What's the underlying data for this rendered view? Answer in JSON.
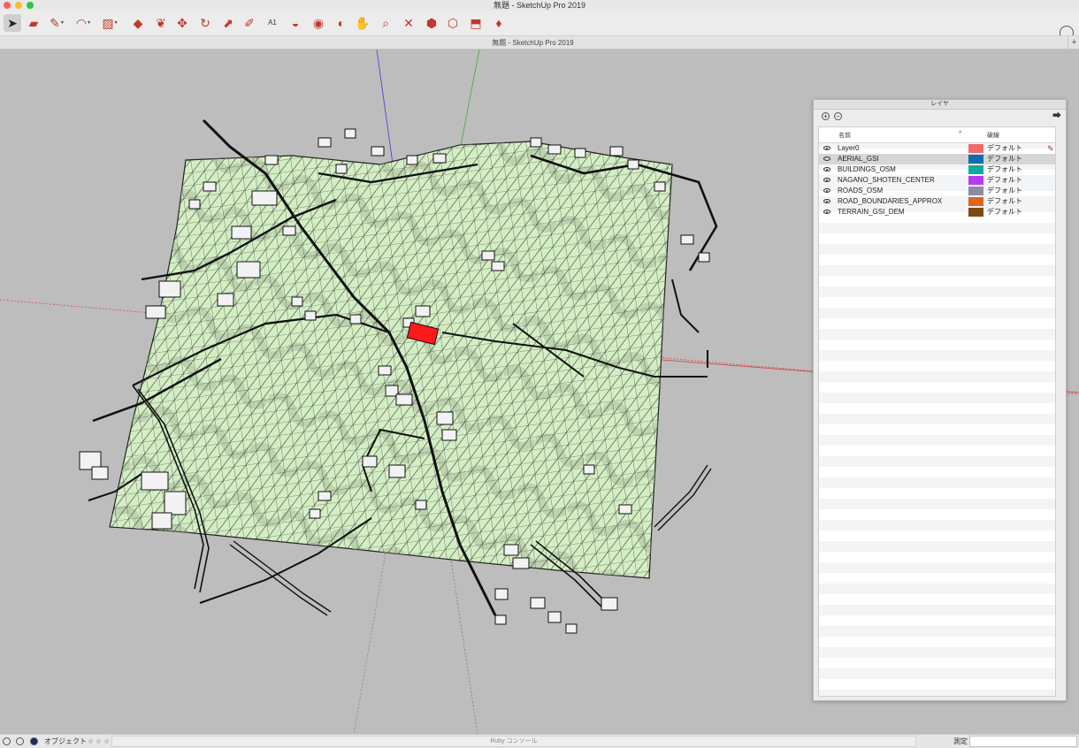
{
  "window": {
    "title": "無題 - SketchUp Pro 2019",
    "document_tab": "無題 - SketchUp Pro 2019"
  },
  "toolbar": {
    "tools": [
      {
        "name": "select-tool",
        "glyph": "➤"
      },
      {
        "name": "eraser-tool",
        "glyph": "▰"
      },
      {
        "name": "line-tool",
        "glyph": "✎"
      },
      {
        "name": "arc-tool",
        "glyph": "◠"
      },
      {
        "name": "rectangle-tool",
        "glyph": "▨"
      },
      {
        "name": "push-pull-tool",
        "glyph": "◆"
      },
      {
        "name": "offset-tool",
        "glyph": "❦"
      },
      {
        "name": "move-tool",
        "glyph": "✥"
      },
      {
        "name": "rotate-tool",
        "glyph": "↻"
      },
      {
        "name": "scale-tool",
        "glyph": "⬈"
      },
      {
        "name": "tape-measure-tool",
        "glyph": "✐"
      },
      {
        "name": "text-tool",
        "glyph": "A1"
      },
      {
        "name": "paint-bucket-tool",
        "glyph": "◒"
      },
      {
        "name": "orbit-tool",
        "glyph": "◉"
      },
      {
        "name": "pan-tool",
        "glyph": "◐"
      },
      {
        "name": "hand-tool",
        "glyph": "✋"
      },
      {
        "name": "zoom-tool",
        "glyph": "⌕"
      },
      {
        "name": "zoom-extents-tool",
        "glyph": "✕"
      },
      {
        "name": "warehouse-tool",
        "glyph": "⬢"
      },
      {
        "name": "extension-warehouse-tool",
        "glyph": "⬡"
      },
      {
        "name": "send-to-layout-tool",
        "glyph": "⬒"
      },
      {
        "name": "extension-manager-tool",
        "glyph": "♦"
      }
    ]
  },
  "layers_panel": {
    "title": "レイヤ",
    "add_label": "+",
    "remove_label": "−",
    "col_name": "名前",
    "col_dash": "破線",
    "sort_glyph": "^",
    "layers": [
      {
        "name": "Layer0",
        "color": "#f06a6a",
        "dash": "デフォルト",
        "visible": true,
        "active": true
      },
      {
        "name": "AERIAL_GSI",
        "color": "#0e6fa8",
        "dash": "デフォルト",
        "visible": false,
        "active": false
      },
      {
        "name": "BUILDINGS_OSM",
        "color": "#13a89e",
        "dash": "デフォルト",
        "visible": true,
        "active": false
      },
      {
        "name": "NAGANO_SHOTEN_CENTER",
        "color": "#b33cf0",
        "dash": "デフォルト",
        "visible": true,
        "active": false
      },
      {
        "name": "ROADS_OSM",
        "color": "#8e8aa6",
        "dash": "デフォルト",
        "visible": true,
        "active": false
      },
      {
        "name": "ROAD_BOUNDARIES_APPROX",
        "color": "#e2641c",
        "dash": "デフォルト",
        "visible": true,
        "active": false
      },
      {
        "name": "TERRAIN_GSI_DEM",
        "color": "#7a4a12",
        "dash": "デフォルト",
        "visible": true,
        "active": false
      }
    ]
  },
  "status": {
    "mode": "オブジェクト",
    "ruby_console": "Ruby コンソール",
    "measure_label": "測定",
    "measure_value": ""
  },
  "colors": {
    "terrain": "#d4eec4",
    "mesh": "#2a2a2a",
    "highlight": "#ff1a1a",
    "axis_red": "#d24a4a",
    "axis_green": "#4caf50",
    "axis_blue": "#4a4ad2",
    "viewport": "#bdbdbd"
  }
}
